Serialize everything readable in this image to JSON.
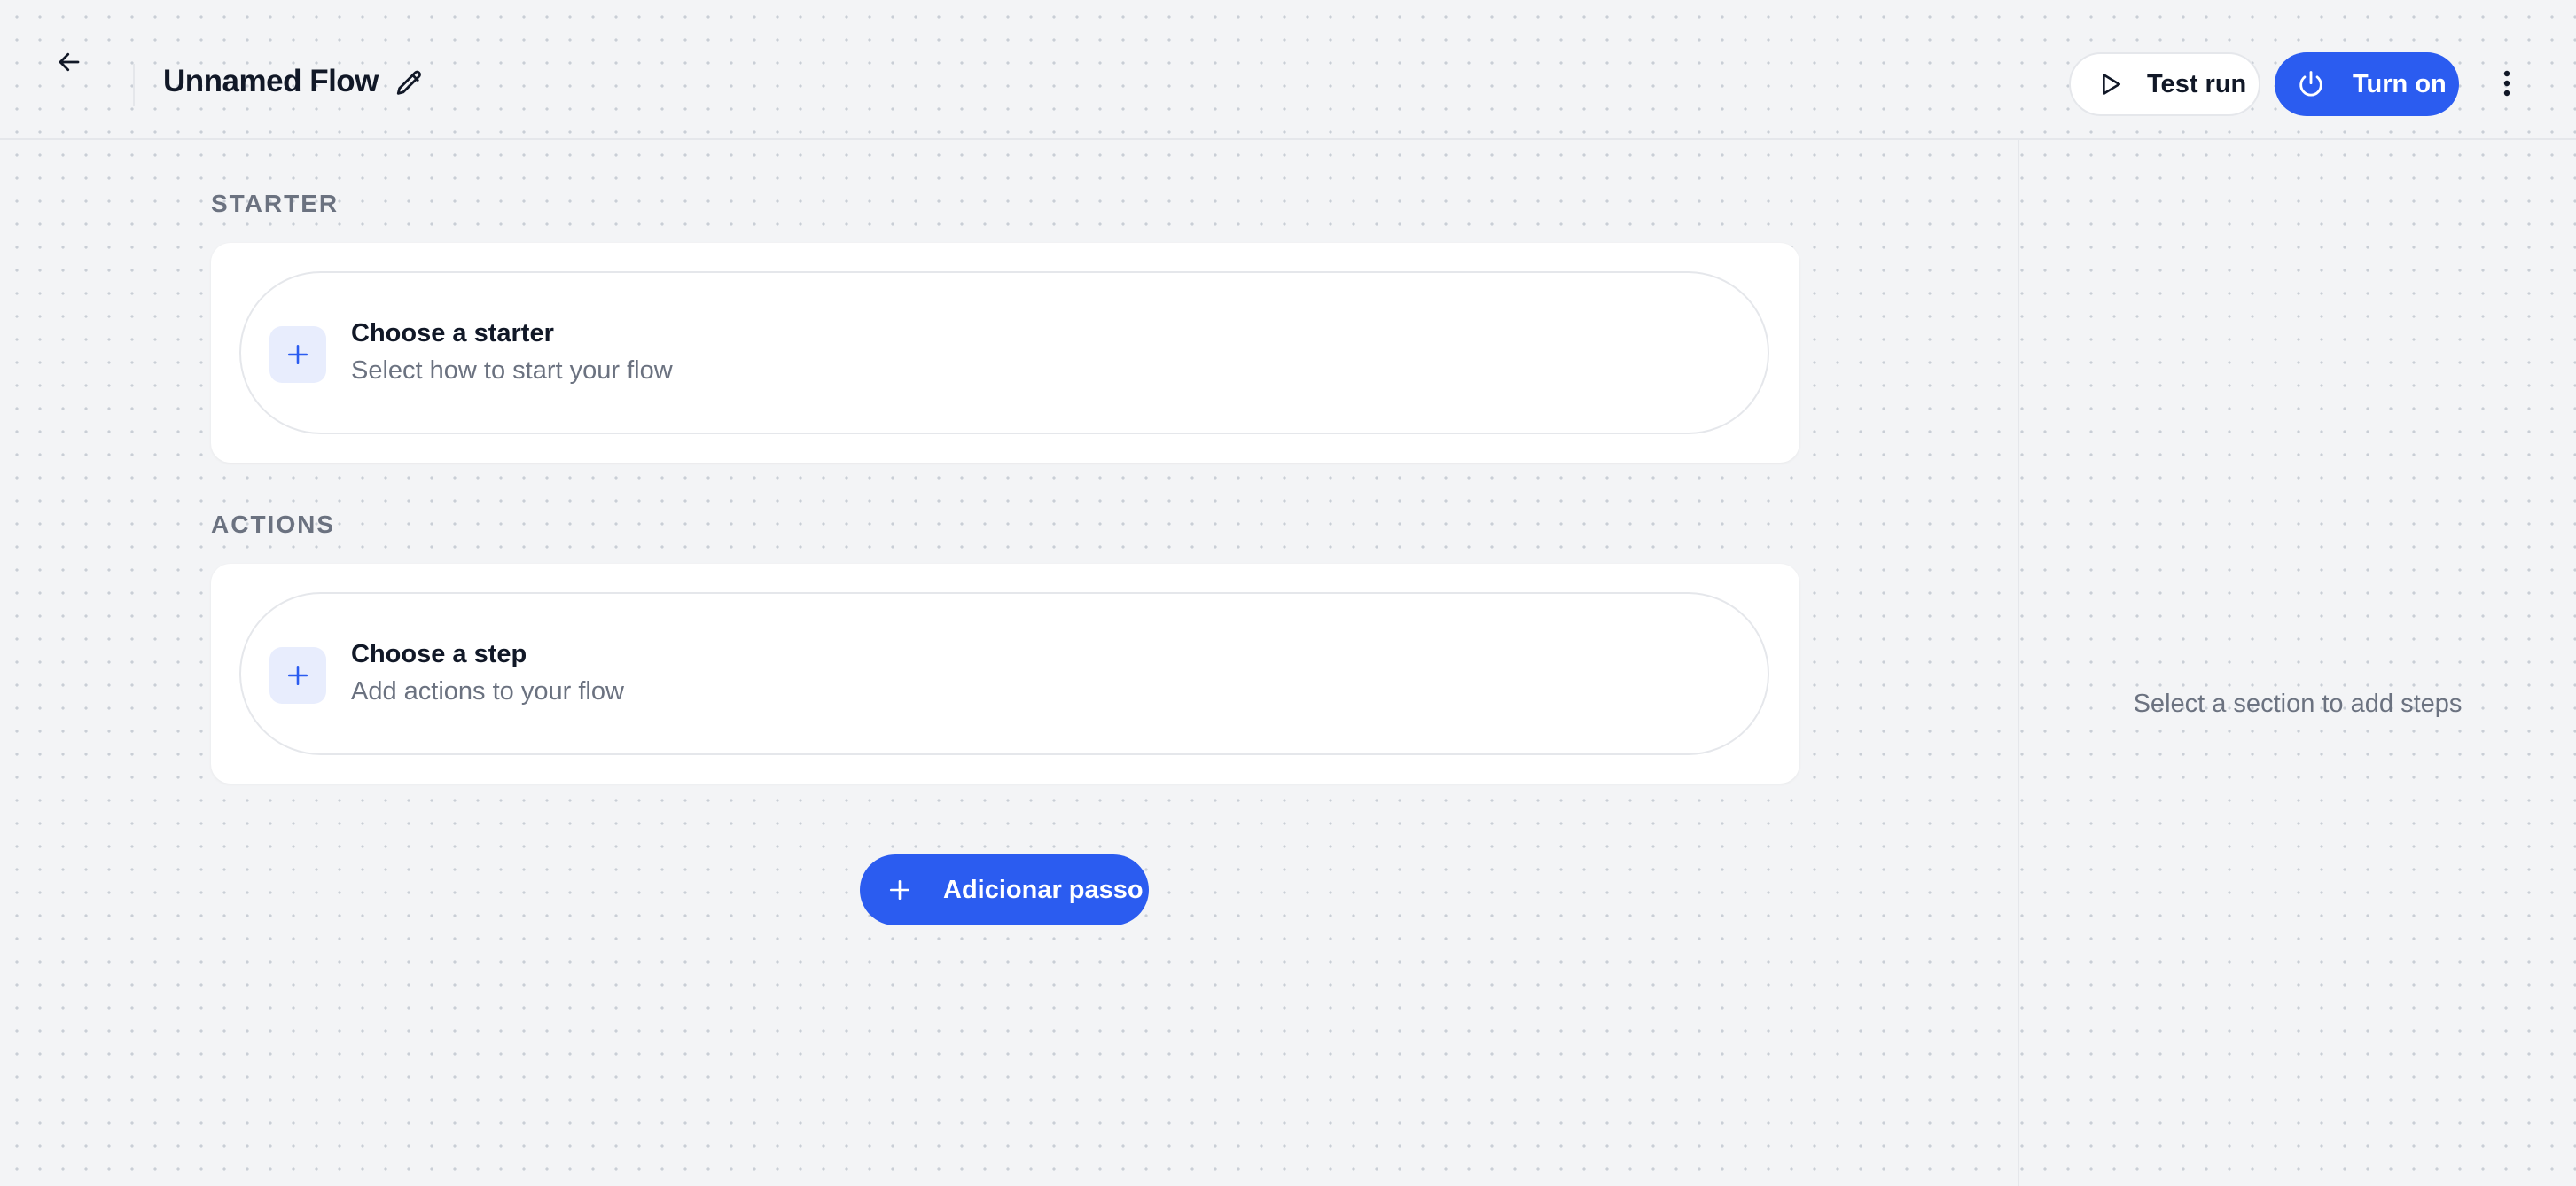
{
  "header": {
    "back_icon": "arrow-left-icon",
    "flow_title": "Unnamed Flow",
    "edit_icon": "pencil-icon",
    "test_run_label": "Test run",
    "test_run_icon": "play-icon",
    "turn_on_label": "Turn on",
    "turn_on_icon": "power-icon",
    "more_icon": "more-vertical-icon"
  },
  "sections": {
    "starter": {
      "label": "STARTER",
      "card_title": "Choose a starter",
      "card_subtitle": "Select how to start your flow",
      "icon": "plus-icon"
    },
    "actions": {
      "label": "ACTIONS",
      "card_title": "Choose a step",
      "card_subtitle": "Add actions to your flow",
      "icon": "plus-icon"
    }
  },
  "add_step": {
    "label": "Adicionar passo",
    "icon": "plus-icon"
  },
  "right_panel": {
    "empty_hint": "Select a section to add steps"
  },
  "colors": {
    "accent": "#2b5cf0",
    "accent_soft": "#e8edfd",
    "background": "#f3f4f6",
    "muted_text": "#6b7280"
  }
}
